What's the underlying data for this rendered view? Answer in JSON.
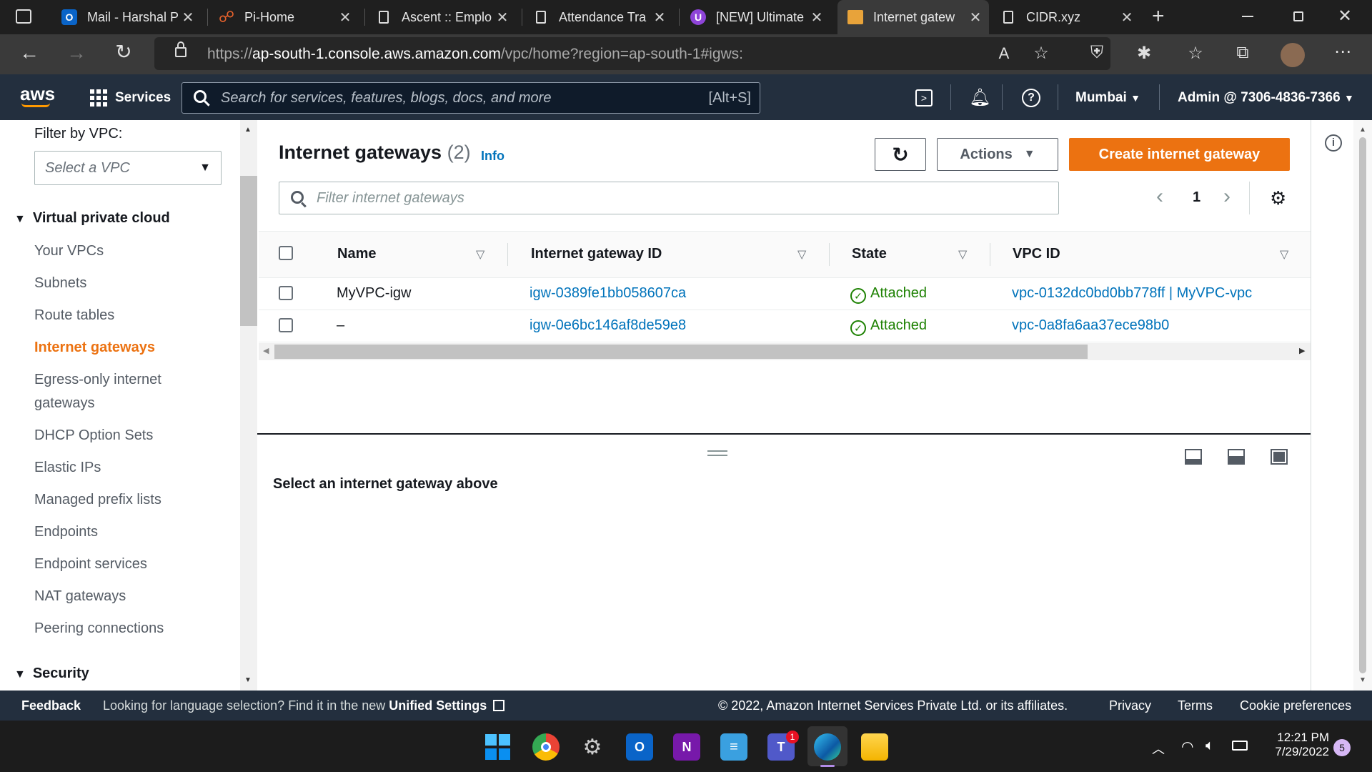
{
  "browser": {
    "tabs": [
      {
        "title": "Mail - Harshal P",
        "icon": "outlook-icon"
      },
      {
        "title": "Pi-Home",
        "icon": "pi-home-icon"
      },
      {
        "title": "Ascent :: Emplo",
        "icon": "page-icon"
      },
      {
        "title": "Attendance Tra",
        "icon": "page-icon"
      },
      {
        "title": "[NEW] Ultimate",
        "icon": "udemy-icon"
      },
      {
        "title": "Internet gatew",
        "icon": "aws-box-icon"
      },
      {
        "title": "CIDR.xyz",
        "icon": "page-icon"
      }
    ],
    "url_prefix": "https://",
    "url_host": "ap-south-1.console.aws.amazon.com",
    "url_path": "/vpc/home?region=ap-south-1#igws:"
  },
  "aws_nav": {
    "logo": "aws",
    "services": "Services",
    "search_placeholder": "Search for services, features, blogs, docs, and more",
    "search_shortcut": "[Alt+S]",
    "region": "Mumbai",
    "account": "Admin @ 7306-4836-7366"
  },
  "sidebar": {
    "filter_label": "Filter by VPC:",
    "filter_placeholder": "Select a VPC",
    "section_vpc": "Virtual private cloud",
    "items": [
      "Your VPCs",
      "Subnets",
      "Route tables",
      "Internet gateways",
      "Egress-only internet",
      "gateways",
      "DHCP Option Sets",
      "Elastic IPs",
      "Managed prefix lists",
      "Endpoints",
      "Endpoint services",
      "NAT gateways",
      "Peering connections"
    ],
    "section_security": "Security"
  },
  "main": {
    "title": "Internet gateways",
    "count": "(2)",
    "info": "Info",
    "actions": "Actions",
    "create": "Create internet gateway",
    "filter_placeholder": "Filter internet gateways",
    "page": "1",
    "columns": [
      "Name",
      "Internet gateway ID",
      "State",
      "VPC ID"
    ],
    "rows": [
      {
        "name": "MyVPC-igw",
        "id": "igw-0389fe1bb058607ca",
        "state": "Attached",
        "vpc": "vpc-0132dc0bd0bb778ff | MyVPC-vpc"
      },
      {
        "name": "–",
        "id": "igw-0e6bc146af8de59e8",
        "state": "Attached",
        "vpc": "vpc-0a8fa6aa37ece98b0"
      }
    ],
    "detail_msg": "Select an internet gateway above"
  },
  "footer": {
    "feedback": "Feedback",
    "lang_msg": "Looking for language selection? Find it in the new",
    "unified": "Unified Settings",
    "copyright": "© 2022, Amazon Internet Services Private Ltd. or its affiliates.",
    "privacy": "Privacy",
    "terms": "Terms",
    "cookie": "Cookie preferences"
  },
  "taskbar": {
    "time": "12:21 PM",
    "date": "7/29/2022",
    "notif_count": "5",
    "teams_badge": "1"
  },
  "colors": {
    "aws_orange": "#ec7211",
    "aws_nav": "#232f3e",
    "link_blue": "#0073bb",
    "success_green": "#1d8102"
  }
}
